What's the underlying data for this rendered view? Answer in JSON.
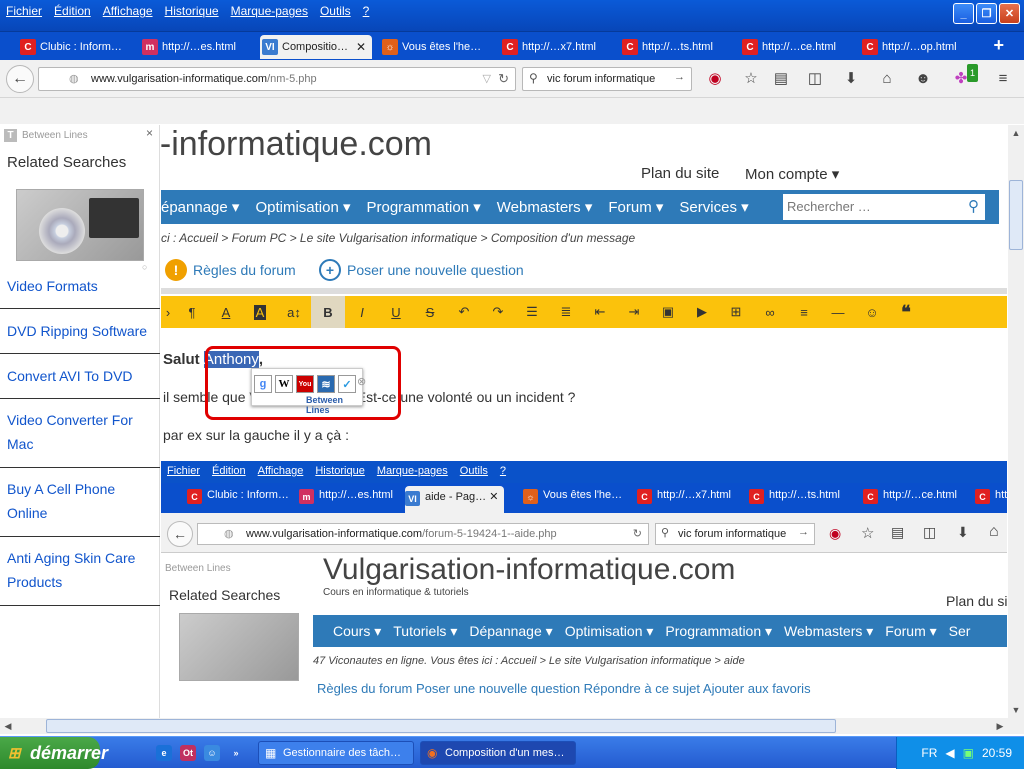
{
  "menubar": {
    "items": [
      "Fichier",
      "Édition",
      "Affichage",
      "Historique",
      "Marque-pages",
      "Outils",
      "?"
    ]
  },
  "tabs": [
    {
      "label": "Clubic : Inform…",
      "icon": "C",
      "color": "#e02020"
    },
    {
      "label": "http://…es.html",
      "icon": "m",
      "color": "#d03060"
    },
    {
      "label": "Compositio…",
      "icon": "VI",
      "color": "#3a7bd0",
      "active": true
    },
    {
      "label": "Vous êtes l'he…",
      "icon": "☼",
      "color": "#e0601a"
    },
    {
      "label": "http://…x7.html",
      "icon": "C",
      "color": "#e02020"
    },
    {
      "label": "http://…ts.html",
      "icon": "C",
      "color": "#e02020"
    },
    {
      "label": "http://…ce.html",
      "icon": "C",
      "color": "#e02020"
    },
    {
      "label": "http://…op.html",
      "icon": "C",
      "color": "#e02020"
    }
  ],
  "navbar": {
    "url_domain": "www.vulgarisation-informatique.com",
    "url_path": "/nm-5.php",
    "search_value": "vic forum informatique",
    "addon_badge": "1"
  },
  "sidebar": {
    "brand": "Between Lines",
    "title": "Related Searches",
    "links": [
      "Video Formats",
      "DVD Ripping Software",
      "Convert AVI To DVD",
      "Video Converter For Mac",
      "Buy A Cell Phone Online",
      "Anti Aging Skin Care Products"
    ]
  },
  "page": {
    "site_title": "n-informatique.com",
    "plan": "Plan du site",
    "compte": "Mon compte ▾",
    "nav": [
      "épannage ▾",
      "Optimisation ▾",
      "Programmation ▾",
      "Webmasters ▾",
      "Forum ▾",
      "Services ▾"
    ],
    "search_placeholder": "Rechercher …",
    "crumb": "ci : Accueil > Forum PC > Le site Vulgarisation informatique > Composition d'un message",
    "regles": "Règles du forum",
    "poser": "Poser une nouvelle question",
    "msg_prefix": "Salut ",
    "msg_highlight": "Anthony",
    "msg_suffix": ",",
    "msg_line2": "il semble que VIC e…         a pub !!! Est-ce une volonté ou un incident ?",
    "msg_line3": "par ex sur la gauche il y a çà :",
    "popup_label": "Between Lines"
  },
  "embedded": {
    "menubar": [
      "Fichier",
      "Édition",
      "Affichage",
      "Historique",
      "Marque-pages",
      "Outils",
      "?"
    ],
    "tabs": [
      {
        "label": "Clubic : Inform…",
        "icon": "C",
        "color": "#e02020"
      },
      {
        "label": "http://…es.html",
        "icon": "m",
        "color": "#d03060"
      },
      {
        "label": "aide - Pag…",
        "icon": "VI",
        "color": "#3a7bd0",
        "active": true
      },
      {
        "label": "Vous êtes l'he…",
        "icon": "☼",
        "color": "#e0601a"
      },
      {
        "label": "http://…x7.html",
        "icon": "C",
        "color": "#e02020"
      },
      {
        "label": "http://…ts.html",
        "icon": "C",
        "color": "#e02020"
      },
      {
        "label": "http://…ce.html",
        "icon": "C",
        "color": "#e02020"
      },
      {
        "label": "htt",
        "icon": "C",
        "color": "#e02020"
      }
    ],
    "url_domain": "www.vulgarisation-informatique.com",
    "url_path": "/forum-5-19424-1--aide.php",
    "search_value": "vic forum informatique",
    "bl_brand": "Between Lines",
    "related": "Related Searches",
    "site_title": "Vulgarisation-informatique.com",
    "site_sub": "Cours en informatique & tutoriels",
    "plan": "Plan du si",
    "nav": [
      "Cours ▾",
      "Tutoriels ▾",
      "Dépannage ▾",
      "Optimisation ▾",
      "Programmation ▾",
      "Webmasters ▾",
      "Forum ▾",
      "Ser"
    ],
    "crumb": "47 Viconautes en ligne. Vous êtes ici : Accueil > Le site Vulgarisation informatique > aide",
    "bottom": "Règles du forum   Poser une nouvelle question   Répondre à ce sujet   Ajouter aux favoris"
  },
  "taskbar": {
    "start": "démarrer",
    "tasks": [
      "Gestionnaire des tâch…",
      "Composition d'un mes…"
    ],
    "lang": "FR",
    "clock": "20:59"
  }
}
